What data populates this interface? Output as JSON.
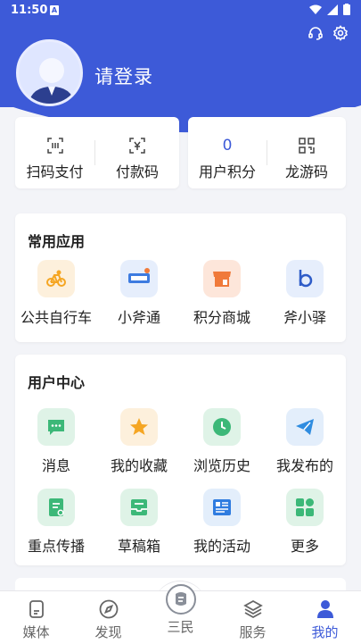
{
  "status_bar": {
    "time": "11:50",
    "notif_icon": "A"
  },
  "header": {
    "login_text": "请登录",
    "accent": "#3d5ad8",
    "icons": [
      "headset-icon",
      "gear-icon"
    ]
  },
  "quick_actions": [
    {
      "label": "扫码支付",
      "icon": "scan-icon"
    },
    {
      "label": "付款码",
      "icon": "payment-code-icon"
    }
  ],
  "account": [
    {
      "label": "用户积分",
      "value": "0"
    },
    {
      "label": "龙游码",
      "icon": "qr-code-icon"
    }
  ],
  "common_apps": {
    "title": "常用应用",
    "items": [
      {
        "label": "公共自行车",
        "icon": "bicycle-icon",
        "color": "#f5a623"
      },
      {
        "label": "小斧通",
        "icon": "xiaofutong-logo-icon",
        "color": "#3d7be0"
      },
      {
        "label": "积分商城",
        "icon": "shop-icon",
        "color": "#f07a3a"
      },
      {
        "label": "斧小驿",
        "icon": "fuxiaoyi-logo-icon",
        "color": "#2e5cc8"
      }
    ]
  },
  "user_center": {
    "title": "用户中心",
    "items": [
      {
        "label": "消息",
        "icon": "message-icon",
        "color": "#3cb878"
      },
      {
        "label": "我的收藏",
        "icon": "star-icon",
        "color": "#f5a623"
      },
      {
        "label": "浏览历史",
        "icon": "clock-icon",
        "color": "#3cb878"
      },
      {
        "label": "我发布的",
        "icon": "send-icon",
        "color": "#2f8ce0"
      },
      {
        "label": "重点传播",
        "icon": "broadcast-doc-icon",
        "color": "#3cb878"
      },
      {
        "label": "草稿箱",
        "icon": "drafts-icon",
        "color": "#3cb878"
      },
      {
        "label": "我的活动",
        "icon": "activity-icon",
        "color": "#2f7ce0"
      },
      {
        "label": "更多",
        "icon": "more-grid-icon",
        "color": "#3cb878"
      }
    ]
  },
  "tabs": [
    {
      "label": "媒体",
      "icon": "media-icon"
    },
    {
      "label": "发现",
      "icon": "compass-icon"
    },
    {
      "label": "三民",
      "icon": "sanmin-logo-icon"
    },
    {
      "label": "服务",
      "icon": "layers-icon"
    },
    {
      "label": "我的",
      "icon": "person-icon",
      "active": true
    }
  ]
}
